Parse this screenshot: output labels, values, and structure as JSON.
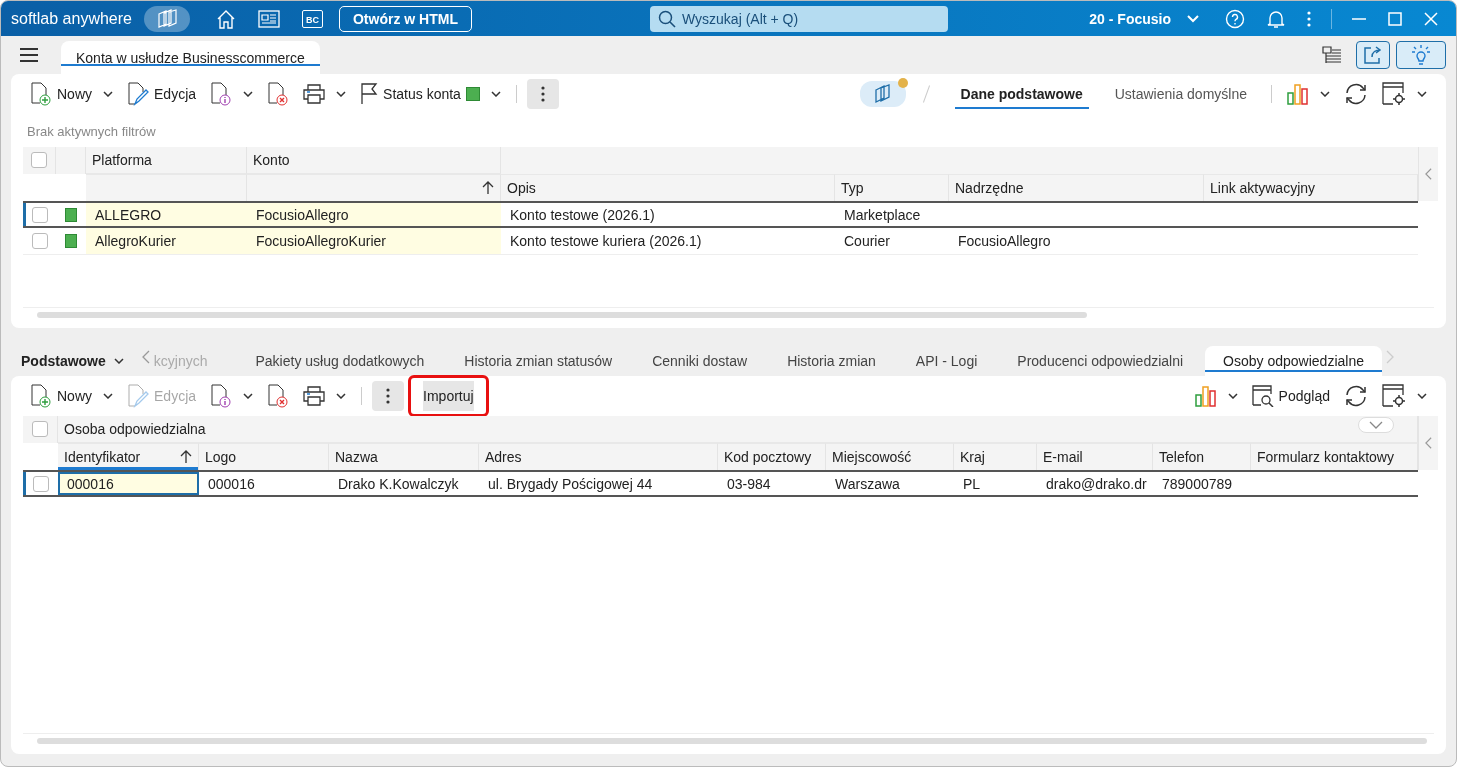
{
  "app_bar": {
    "brand": "softlab anywhere",
    "bc_badge": "BC",
    "open_html": "Otwórz w HTML",
    "search_placeholder": "Wyszukaj (Alt + Q)",
    "company": "20 - Focusio"
  },
  "document_tab": {
    "label": "Konta w usłudze Businesscommerce",
    "selected": true
  },
  "top_toolbar": [
    {
      "kind": "new",
      "label": "Nowy",
      "dropdown": true,
      "disabled": false
    },
    {
      "kind": "edit",
      "label": "Edycja",
      "dropdown": false,
      "disabled": false
    },
    {
      "kind": "info",
      "dropdown": true,
      "disabled": false
    },
    {
      "kind": "delete",
      "dropdown": false,
      "disabled": false
    },
    {
      "kind": "print",
      "dropdown": true,
      "disabled": false
    },
    {
      "kind": "flag",
      "label": "Status konta",
      "color": "#4caf50",
      "dropdown": true,
      "disabled": false
    },
    {
      "kind": "more",
      "dropdown": false,
      "disabled": false
    }
  ],
  "view_tabs": [
    {
      "label": "Dane podstawowe",
      "selected": true
    },
    {
      "label": "Ustawienia domyślne",
      "selected": false
    }
  ],
  "filter_status": "Brak aktywnych filtrów",
  "accounts_table": {
    "all_checked": false,
    "columns": [
      {
        "title": "Platforma",
        "sorted": false
      },
      {
        "title": "Konto",
        "sorted": true
      },
      {
        "title": "Opis",
        "sorted": false
      },
      {
        "title": "Typ",
        "sorted": false
      },
      {
        "title": "Nadrzędne",
        "sorted": false
      },
      {
        "title": "Link aktywacyjny",
        "sorted": false
      }
    ],
    "rows": [
      {
        "selected": true,
        "checked": false,
        "color": "#4caf50",
        "cells": [
          "ALLEGRO",
          "FocusioAllegro",
          "Konto testowe (2026.1)",
          "Marketplace",
          "",
          ""
        ]
      },
      {
        "selected": false,
        "checked": false,
        "color": "#4caf50",
        "cells": [
          "AllegroKurier",
          "FocusioAllegroKurier",
          "Konto testowe kuriera (2026.1)",
          "Courier",
          "FocusioAllegro",
          ""
        ]
      }
    ]
  },
  "section_menu": "Podstawowe",
  "detail_tabs": [
    {
      "label": "kcyjnych",
      "selected": false,
      "faded": true
    },
    {
      "label": "Pakiety usług dodatkowych",
      "selected": false,
      "faded": false
    },
    {
      "label": "Historia zmian statusów",
      "selected": false,
      "faded": false
    },
    {
      "label": "Cenniki dostaw",
      "selected": false,
      "faded": false
    },
    {
      "label": "Historia zmian",
      "selected": false,
      "faded": false
    },
    {
      "label": "API - Logi",
      "selected": false,
      "faded": false
    },
    {
      "label": "Producenci odpowiedzialni",
      "selected": false,
      "faded": false
    },
    {
      "label": "Osoby odpowiedzialne",
      "selected": true,
      "faded": false
    }
  ],
  "bottom_toolbar": [
    {
      "kind": "new",
      "label": "Nowy",
      "dropdown": true,
      "disabled": false,
      "highlighted": false
    },
    {
      "kind": "edit",
      "label": "Edycja",
      "dropdown": false,
      "disabled": true,
      "highlighted": false
    },
    {
      "kind": "info",
      "dropdown": true,
      "disabled": false,
      "highlighted": false
    },
    {
      "kind": "delete",
      "dropdown": false,
      "disabled": false,
      "highlighted": false
    },
    {
      "kind": "print",
      "dropdown": true,
      "disabled": false,
      "highlighted": false
    },
    {
      "kind": "more",
      "dropdown": false,
      "disabled": false,
      "highlighted": false
    },
    {
      "kind": "text",
      "label": "Importuj",
      "dropdown": false,
      "disabled": false,
      "highlighted": true
    }
  ],
  "preview_label": "Podgląd",
  "persons_table": {
    "all_checked": false,
    "group_header": "Osoba odpowiedzialna",
    "columns": [
      {
        "title": "Identyfikator",
        "sorted": true
      },
      {
        "title": "Logo",
        "sorted": false
      },
      {
        "title": "Nazwa",
        "sorted": false
      },
      {
        "title": "Adres",
        "sorted": false
      },
      {
        "title": "Kod pocztowy",
        "sorted": false
      },
      {
        "title": "Miejscowość",
        "sorted": false
      },
      {
        "title": "Kraj",
        "sorted": false
      },
      {
        "title": "E-mail",
        "sorted": false
      },
      {
        "title": "Telefon",
        "sorted": false
      },
      {
        "title": "Formularz kontaktowy",
        "sorted": false
      }
    ],
    "rows": [
      {
        "selected": true,
        "checked": false,
        "cells": [
          "000016",
          "000016",
          "Drako K.Kowalczyk",
          "ul. Brygady Pościgowej 44",
          "03-984",
          "Warszawa",
          "PL",
          "drako@drako.dr",
          "789000789",
          ""
        ]
      }
    ]
  }
}
